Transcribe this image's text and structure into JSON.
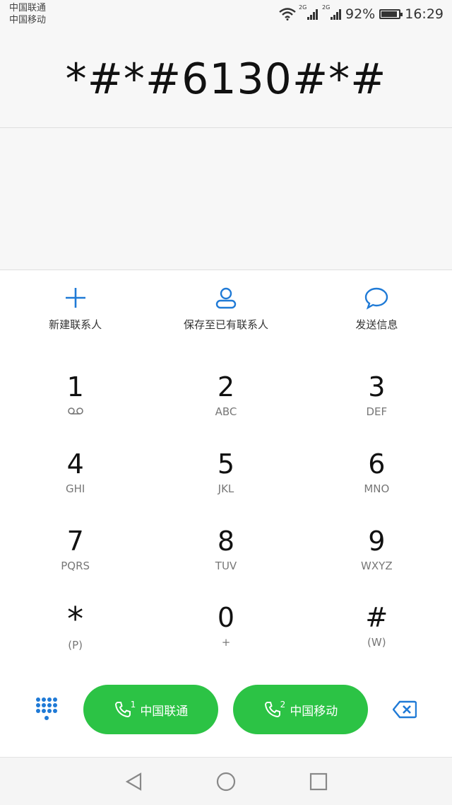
{
  "status_bar": {
    "carrier1": "中国联通",
    "carrier2": "中国移动",
    "net1": "2G",
    "net2": "2G",
    "battery": "92%",
    "battery_level": 0.92,
    "time": "16:29"
  },
  "dialer": {
    "number": "*#*#6130#*#"
  },
  "actions": [
    {
      "label": "新建联系人",
      "icon": "plus-icon"
    },
    {
      "label": "保存至已有联系人",
      "icon": "person-icon"
    },
    {
      "label": "发送信息",
      "icon": "message-icon"
    }
  ],
  "keypad": [
    {
      "digit": "1",
      "sub": ""
    },
    {
      "digit": "2",
      "sub": "ABC"
    },
    {
      "digit": "3",
      "sub": "DEF"
    },
    {
      "digit": "4",
      "sub": "GHI"
    },
    {
      "digit": "5",
      "sub": "JKL"
    },
    {
      "digit": "6",
      "sub": "MNO"
    },
    {
      "digit": "7",
      "sub": "PQRS"
    },
    {
      "digit": "8",
      "sub": "TUV"
    },
    {
      "digit": "9",
      "sub": "WXYZ"
    },
    {
      "digit": "*",
      "sub": "(P)"
    },
    {
      "digit": "0",
      "sub": "+"
    },
    {
      "digit": "#",
      "sub": "(W)"
    }
  ],
  "call_buttons": [
    {
      "sim": "1",
      "label": "中国联通"
    },
    {
      "sim": "2",
      "label": "中国移动"
    }
  ],
  "colors": {
    "accent_blue": "#1f7ad6",
    "call_green": "#2cc345"
  }
}
